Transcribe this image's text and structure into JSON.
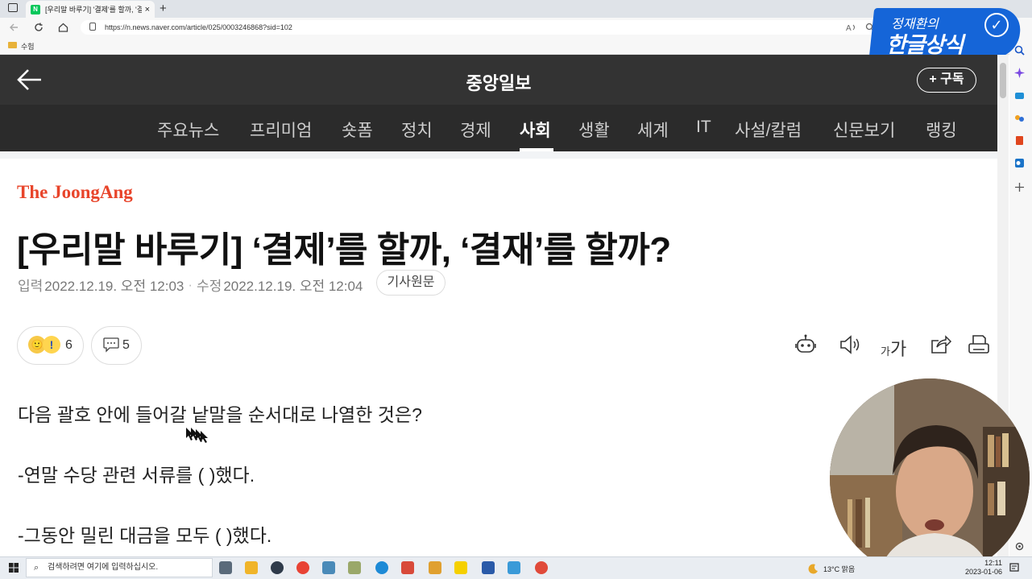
{
  "browser": {
    "tab_title": "[우리말 바루기] '결제'를 할까, '결",
    "tab_favicon": "N",
    "tab_close": "×",
    "new_tab": "+",
    "url": "https://n.news.naver.com/article/025/0003246868?sid=102",
    "bookmark_folder": "수험"
  },
  "overlay_logo": {
    "line1": "정재환의",
    "line2": "한글상식",
    "check": "✓"
  },
  "header": {
    "press_name": "중앙일보",
    "subscribe_label": "+ 구독"
  },
  "menu": {
    "items": [
      "주요뉴스",
      "프리미엄",
      "숏폼",
      "정치",
      "경제",
      "사회",
      "생활",
      "세계",
      "IT",
      "사설/칼럼",
      "신문보기",
      "랭킹"
    ],
    "active": "사회"
  },
  "article": {
    "brand": "The JoongAng",
    "title": "[우리말 바루기] ‘결제’를 할까, ‘결재’를 할까?",
    "input_label": "입력",
    "input_date": "2022.12.19. 오전 12:03",
    "edit_label": "수정",
    "edit_date": "2022.12.19. 오전 12:04",
    "source_button": "기사원문",
    "reaction_count": "6",
    "comment_count": "5",
    "font_small": "가",
    "font_big": "가",
    "paragraphs": [
      "다음 괄호 안에 들어갈 낱말을 순서대로 나열한 것은?",
      "-연말 수당 관련 서류를 ( )했다.",
      "-그동안 밀린 대금을 모두 ( )했다."
    ]
  },
  "taskbar": {
    "search_placeholder": "검색하려면 여기에 입력하십시오.",
    "weather": "13°C 맑음",
    "time": "12:11",
    "date": "2023-01-06"
  },
  "colors": {
    "header_bg": "#333333",
    "menu_bg": "#2b2b2b",
    "brand_red": "#e8442a",
    "logo_blue": "#1565d8"
  }
}
